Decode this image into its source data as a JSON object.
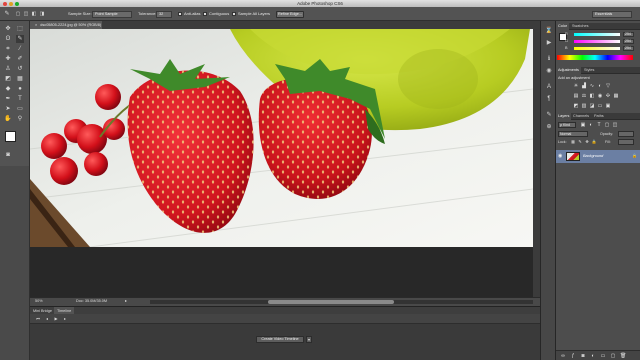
{
  "window": {
    "title": "Adobe Photoshop CS6"
  },
  "options_bar": {
    "sample_size_label": "Sample Size:",
    "sample_size_value": "Point Sample",
    "tolerance_label": "Tolerance:",
    "tolerance_value": "32",
    "anti_alias_label": "Anti-alias",
    "contiguous_label": "Contiguous",
    "sample_all_layers_label": "Sample All Layers",
    "refine_edge_label": "Refine Edge...",
    "workspace_value": "Essentials"
  },
  "document": {
    "tab_label": "dsc05805-2224.jpg @ 50% (RGB/8)",
    "tab_close": "×",
    "zoom": "50%",
    "doc_size": "Doc: 35.0M/35.0M"
  },
  "bottom_tabs": {
    "mini_bridge": "Mini Bridge",
    "timeline": "Timeline"
  },
  "timeline": {
    "create_button": "Create Video Timeline",
    "menu_glyph": "▾"
  },
  "color_panel": {
    "tab_color": "Color",
    "tab_swatches": "Swatches",
    "channels": [
      {
        "label": "R",
        "value": "254"
      },
      {
        "label": "G",
        "value": "254"
      },
      {
        "label": "B",
        "value": "254"
      }
    ]
  },
  "adjustments_panel": {
    "tab_adjustments": "Adjustments",
    "tab_styles": "Styles",
    "add_label": "Add an adjustment"
  },
  "layers_panel": {
    "tab_layers": "Layers",
    "tab_channels": "Channels",
    "tab_paths": "Paths",
    "kind_label": "ρ Kind",
    "blend_mode": "Normal",
    "opacity_label": "Opacity:",
    "lock_label": "Lock:",
    "fill_label": "Fill:",
    "layer_name": "Background"
  },
  "colors": {
    "ui_panel": "#535353",
    "canvas_backdrop": "#282828",
    "accent_tab": "#595959"
  }
}
